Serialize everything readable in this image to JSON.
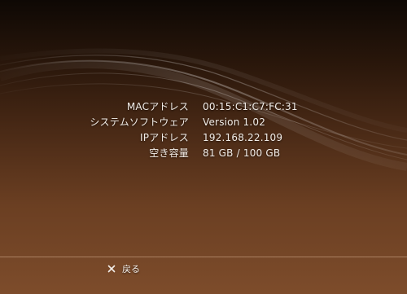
{
  "system_info": {
    "rows": [
      {
        "label": "MACアドレス",
        "value": "00:15:C1:C7:FC:31"
      },
      {
        "label": "システムソフトウェア",
        "value": "Version 1.02"
      },
      {
        "label": "IPアドレス",
        "value": "192.168.22.109"
      },
      {
        "label": "空き容量",
        "value": "81 GB / 100 GB"
      }
    ]
  },
  "footer": {
    "back_icon": "cross-button-icon",
    "back_label": "戻る"
  },
  "colors": {
    "background_top": "#0e0804",
    "background_bottom": "#7d4c2b",
    "text": "#f2ede8"
  }
}
